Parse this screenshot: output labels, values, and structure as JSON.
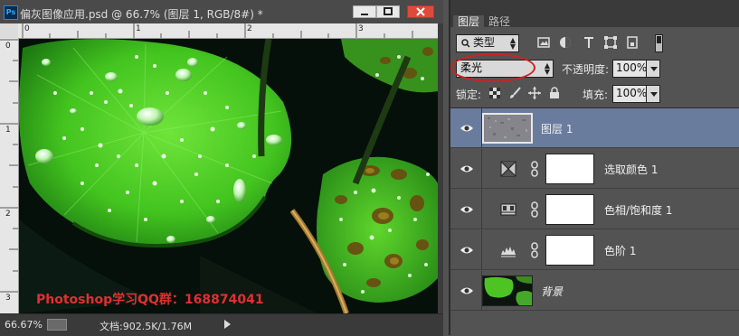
{
  "document": {
    "title": "偏灰图像应用.psd @ 66.7% (图层 1, RGB/8#) *",
    "app_icon_text": "Ps",
    "ruler_h_labels": [
      "0",
      "1",
      "2",
      "3",
      "4"
    ],
    "ruler_v_labels": [
      "0",
      "1",
      "2",
      "3"
    ],
    "watermark": "Photoshop学习QQ群：168874041",
    "status": {
      "zoom": "66.67%",
      "doc_info": "文档:902.5K/1.76M"
    }
  },
  "panel": {
    "tabs": [
      "图层",
      "路径"
    ],
    "active_tab": "图层",
    "filter": {
      "label": "类型",
      "icon": "search-icon"
    },
    "filter_icons": [
      "image-filter-icon",
      "adjustment-filter-icon",
      "type-filter-icon",
      "shape-filter-icon",
      "smart-object-filter-icon"
    ],
    "blend_mode": "柔光",
    "opacity_label": "不透明度:",
    "opacity": "100%",
    "lock_label": "锁定:",
    "lock_icons": [
      "lock-transparent-icon",
      "lock-paint-icon",
      "lock-move-icon",
      "lock-all-icon"
    ],
    "fill_label": "填充:",
    "fill": "100%",
    "layers": [
      {
        "name": "图层 1",
        "kind": "pixel",
        "selected": true,
        "visible": true
      },
      {
        "name": "选取颜色 1",
        "kind": "adjustment",
        "icon": "selective-color-icon",
        "visible": true
      },
      {
        "name": "色相/饱和度 1",
        "kind": "adjustment",
        "icon": "hue-saturation-icon",
        "visible": true
      },
      {
        "name": "色阶 1",
        "kind": "adjustment",
        "icon": "levels-icon",
        "visible": true
      },
      {
        "name": "背景",
        "kind": "background",
        "visible": true
      }
    ]
  },
  "colors": {
    "selection": "#6a7c9e",
    "annotation_circle": "#d02020",
    "watermark": "#e03030"
  }
}
